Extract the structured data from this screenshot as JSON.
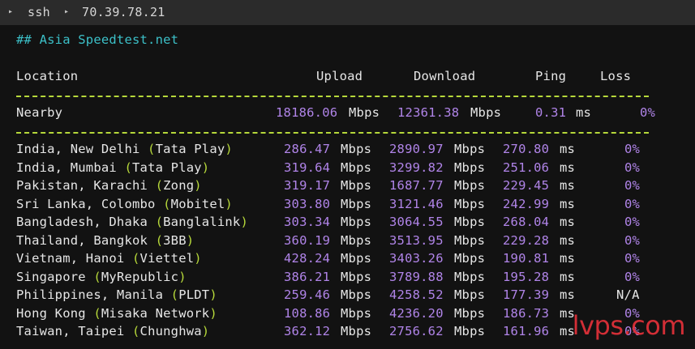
{
  "tabbar": {
    "items": [
      "ssh",
      "70.39.78.21"
    ],
    "separator_icon": "triangle-right-icon"
  },
  "heading": "## Asia Speedtest.net",
  "columns": {
    "location": "Location",
    "upload": "Upload",
    "download": "Download",
    "ping": "Ping",
    "loss": "Loss"
  },
  "nearby": {
    "location": "Nearby",
    "upload": "18186.06",
    "upload_unit": "Mbps",
    "download": "12361.38",
    "download_unit": "Mbps",
    "ping": "0.31",
    "ping_unit": "ms",
    "loss": "0%"
  },
  "rows": [
    {
      "place": "India, New Delhi ",
      "isp": "Tata Play",
      "upload": "286.47",
      "download": "2890.97",
      "ping": "270.80",
      "loss": "0%"
    },
    {
      "place": "India, Mumbai ",
      "isp": "Tata Play",
      "upload": "319.64",
      "download": "3299.82",
      "ping": "251.06",
      "loss": "0%"
    },
    {
      "place": "Pakistan, Karachi ",
      "isp": "Zong",
      "upload": "319.17",
      "download": "1687.77",
      "ping": "229.45",
      "loss": "0%"
    },
    {
      "place": "Sri Lanka, Colombo ",
      "isp": "Mobitel",
      "upload": "303.80",
      "download": "3121.46",
      "ping": "242.99",
      "loss": "0%"
    },
    {
      "place": "Bangladesh, Dhaka ",
      "isp": "Banglalink",
      "upload": "303.34",
      "download": "3064.55",
      "ping": "268.04",
      "loss": "0%"
    },
    {
      "place": "Thailand, Bangkok ",
      "isp": "3BB",
      "upload": "360.19",
      "download": "3513.95",
      "ping": "229.28",
      "loss": "0%"
    },
    {
      "place": "Vietnam, Hanoi ",
      "isp": "Viettel",
      "upload": "428.24",
      "download": "3403.26",
      "ping": "190.81",
      "loss": "0%"
    },
    {
      "place": "Singapore ",
      "isp": "MyRepublic",
      "upload": "386.21",
      "download": "3789.88",
      "ping": "195.28",
      "loss": "0%"
    },
    {
      "place": "Philippines, Manila ",
      "isp": "PLDT",
      "upload": "259.46",
      "download": "4258.52",
      "ping": "177.39",
      "loss": "N/A"
    },
    {
      "place": "Hong Kong ",
      "isp": "Misaka Network",
      "upload": "108.86",
      "download": "4236.20",
      "ping": "186.73",
      "loss": "0%"
    },
    {
      "place": "Taiwan, Taipei ",
      "isp": "Chunghwa",
      "upload": "362.12",
      "download": "2756.62",
      "ping": "161.96",
      "loss": "0%"
    }
  ],
  "units": {
    "speed": "Mbps",
    "time": "ms"
  },
  "watermark": "lvps.com",
  "colors": {
    "background": "#121212",
    "tabbar": "#2b2b2b",
    "text": "#e6e6e6",
    "number": "#b084e8",
    "paren_and_dashes": "#b6d83a",
    "heading": "#3cc0c8",
    "watermark": "#e8323a"
  }
}
